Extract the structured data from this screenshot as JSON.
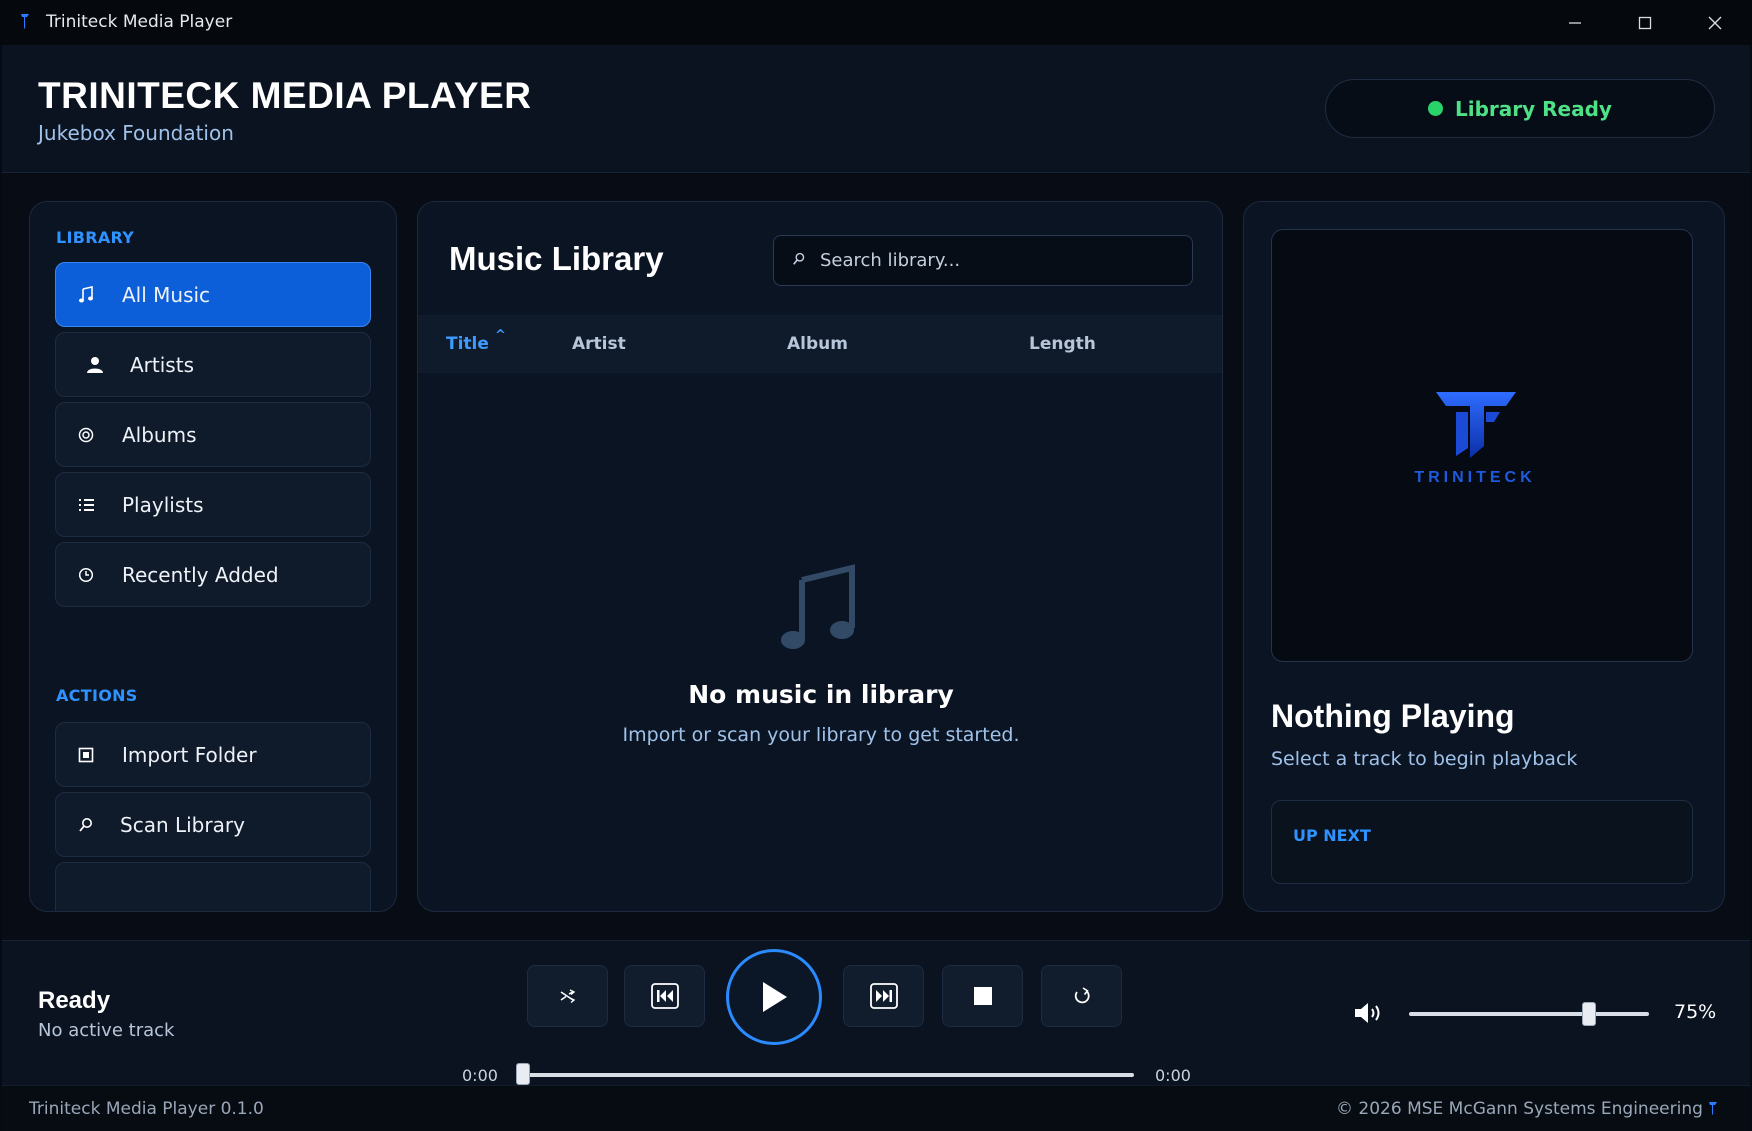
{
  "window": {
    "title": "Triniteck Media Player",
    "minimize_icon": "minimize-icon",
    "maximize_icon": "maximize-icon",
    "close_icon": "close-icon"
  },
  "header": {
    "title": "TRINITECK MEDIA PLAYER",
    "subtitle": "Jukebox Foundation",
    "status": "Library Ready",
    "status_color": "#29d36a"
  },
  "sidebar": {
    "library_label": "LIBRARY",
    "library_items": [
      {
        "label": "All Music",
        "icon": "music-note-icon",
        "active": true
      },
      {
        "label": "Artists",
        "icon": "person-icon",
        "active": false
      },
      {
        "label": "Albums",
        "icon": "disc-icon",
        "active": false
      },
      {
        "label": "Playlists",
        "icon": "list-icon",
        "active": false
      },
      {
        "label": "Recently Added",
        "icon": "clock-icon",
        "active": false
      }
    ],
    "actions_label": "ACTIONS",
    "action_items": [
      {
        "label": "Import Folder",
        "icon": "folder-icon"
      },
      {
        "label": "Scan Library",
        "icon": "search-icon"
      }
    ]
  },
  "library": {
    "title": "Music Library",
    "search_placeholder": "Search library...",
    "columns": [
      "Title",
      "Artist",
      "Album",
      "Length"
    ],
    "sorted_column": "Title",
    "sort_direction": "ascending",
    "empty_title": "No music in library",
    "empty_subtitle": "Import or scan your library to get started."
  },
  "now_playing": {
    "logo_text": "TRINITECK",
    "title": "Nothing Playing",
    "subtitle": "Select a track to begin playback",
    "up_next_label": "UP NEXT"
  },
  "player": {
    "state": "Ready",
    "track": "No active track",
    "elapsed": "0:00",
    "duration": "0:00",
    "progress": 0,
    "volume_label": "75%",
    "volume": 0.75,
    "controls": [
      "shuffle-icon",
      "previous-icon",
      "play-icon",
      "next-icon",
      "stop-icon",
      "repeat-icon"
    ]
  },
  "footer": {
    "version": "Triniteck Media Player 0.1.0",
    "copyright": "© 2026 MSE McGann Systems Engineering"
  },
  "colors": {
    "accent": "#2f93ff",
    "active_nav": "#0c5fd8",
    "background": "#070c15"
  }
}
